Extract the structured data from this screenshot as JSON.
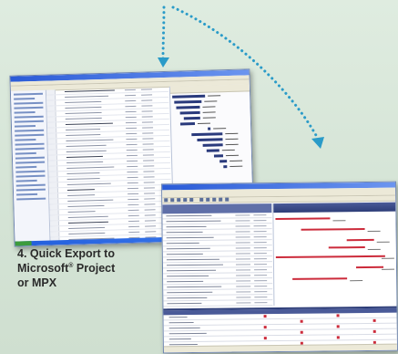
{
  "caption": {
    "line1": "4. Quick Export to",
    "line2_word": "Microsoft",
    "line2_mark": "®",
    "line2_rest": " Project",
    "line3": "or MPX"
  },
  "colors": {
    "arrow": "#2a9bc8",
    "gantt_bar": "#2a3a7c",
    "schedule_bar": "#cc2b3b"
  }
}
